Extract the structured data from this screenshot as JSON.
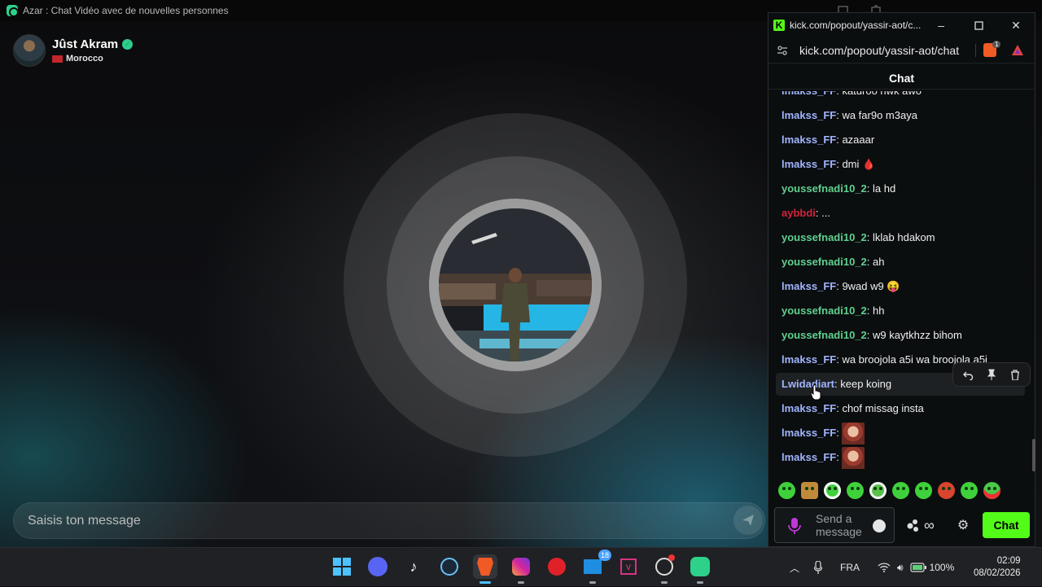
{
  "azar": {
    "window_title": "Azar : Chat Vidéo avec de nouvelles personnes",
    "profile": {
      "name": "Jûst Akram",
      "country": "Morocco"
    },
    "message_placeholder": "Saisis ton message"
  },
  "kick": {
    "tab_title": "kick.com/popout/yassir-aot/c...",
    "url": "kick.com/popout/yassir-aot/chat",
    "extension_badge": "1",
    "chat_header": "Chat",
    "messages": [
      {
        "user": "lmakss_FF",
        "text": "katuroo nwk awo",
        "user_color": "#a1b5ff"
      },
      {
        "user": "lmakss_FF",
        "text": "wa far9o m3aya",
        "user_color": "#a1b5ff"
      },
      {
        "user": "lmakss_FF",
        "text": "azaaar",
        "user_color": "#a1b5ff"
      },
      {
        "user": "lmakss_FF",
        "text": "dmi 🩸",
        "user_color": "#a1b5ff"
      },
      {
        "user": "youssefnadi10_2",
        "text": "la hd",
        "user_color": "#5fd08f"
      },
      {
        "user": "aybbdi",
        "text": "...",
        "user_color": "#d0243b"
      },
      {
        "user": "youssefnadi10_2",
        "text": "lklab hdakom",
        "user_color": "#5fd08f"
      },
      {
        "user": "youssefnadi10_2",
        "text": "ah",
        "user_color": "#5fd08f"
      },
      {
        "user": "lmakss_FF",
        "text": "9wad w9 😝",
        "user_color": "#a1b5ff"
      },
      {
        "user": "youssefnadi10_2",
        "text": "hh",
        "user_color": "#5fd08f"
      },
      {
        "user": "youssefnadi10_2",
        "text": "w9 kaytkhzz bihom",
        "user_color": "#5fd08f"
      },
      {
        "user": "lmakss_FF",
        "text": "wa broojola a5i wa broojola a5i",
        "user_color": "#a1b5ff"
      },
      {
        "user": "Lwidadiart",
        "text": "keep koing",
        "user_color": "#a1b5ff"
      },
      {
        "user": "lmakss_FF",
        "text": "chof missag insta",
        "user_color": "#a1b5ff"
      },
      {
        "user": "lmakss_FF",
        "text": "",
        "emote": true,
        "user_color": "#a1b5ff"
      },
      {
        "user": "lmakss_FF",
        "text": "",
        "emote": true,
        "user_color": "#a1b5ff"
      }
    ],
    "input_placeholder": "Send a message",
    "send_label": "Chat",
    "accent": "#53fc18"
  },
  "taskbar": {
    "mail_badge": "18",
    "language": "FRA",
    "battery": "100%",
    "time": "02:09",
    "date": "08/02/2026"
  }
}
